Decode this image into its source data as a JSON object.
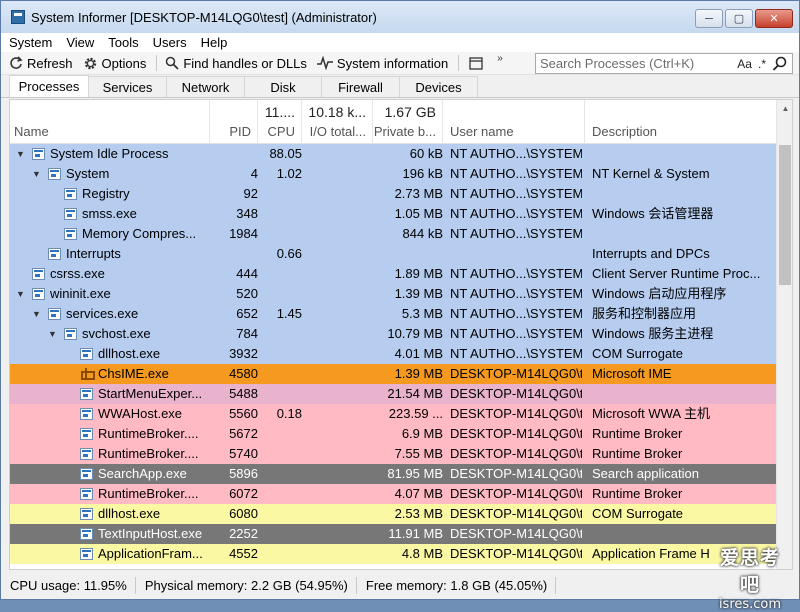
{
  "window": {
    "title": "System Informer [DESKTOP-M14LQG0\\test] (Administrator)",
    "minimize_glyph": "─",
    "maximize_glyph": "▢",
    "close_glyph": "✕"
  },
  "menu": [
    "System",
    "View",
    "Tools",
    "Users",
    "Help"
  ],
  "toolbar": {
    "refresh": "Refresh",
    "options": "Options",
    "find": "Find handles or DLLs",
    "sysinfo": "System information",
    "more": "»"
  },
  "search": {
    "placeholder": "Search Processes (Ctrl+K)",
    "case_option": "Aa",
    "regex_option": ".*"
  },
  "tabs": [
    "Processes",
    "Services",
    "Network",
    "Disk",
    "Firewall",
    "Devices"
  ],
  "columns": {
    "name": "Name",
    "pid": "PID",
    "cpu": "CPU",
    "io": "I/O total...",
    "private": "Private b...",
    "user": "User name",
    "desc": "Description",
    "cpu_total": "11....",
    "io_total": "10.18 k...",
    "private_total": "1.67 GB"
  },
  "colors": {
    "system": "#b6cdf0",
    "service": "#b6cdf0",
    "ime": "#f59a1f",
    "immersive": "#e9b3cd",
    "user": "#ffbac4",
    "suspended": "#777777",
    "dotnet": "#fbf8a4"
  },
  "processes": [
    {
      "name": "System Idle Process",
      "level": 0,
      "expanded": true,
      "pid": "",
      "cpu": "88.05",
      "private": "60 kB",
      "user": "NT AUTHO...\\SYSTEM",
      "desc": "",
      "color": "system"
    },
    {
      "name": "System",
      "level": 1,
      "expanded": true,
      "pid": "4",
      "cpu": "1.02",
      "private": "196 kB",
      "user": "NT AUTHO...\\SYSTEM",
      "desc": "NT Kernel & System",
      "color": "system"
    },
    {
      "name": "Registry",
      "level": 2,
      "expanded": null,
      "pid": "92",
      "cpu": "",
      "private": "2.73 MB",
      "user": "NT AUTHO...\\SYSTEM",
      "desc": "",
      "color": "system"
    },
    {
      "name": "smss.exe",
      "level": 2,
      "expanded": null,
      "pid": "348",
      "cpu": "",
      "private": "1.05 MB",
      "user": "NT AUTHO...\\SYSTEM",
      "desc": "Windows 会话管理器",
      "color": "system"
    },
    {
      "name": "Memory Compres...",
      "level": 2,
      "expanded": null,
      "pid": "1984",
      "cpu": "",
      "private": "844 kB",
      "user": "NT AUTHO...\\SYSTEM",
      "desc": "",
      "color": "system"
    },
    {
      "name": "Interrupts",
      "level": 1,
      "expanded": null,
      "pid": "",
      "cpu": "0.66",
      "private": "",
      "user": "",
      "desc": "Interrupts and DPCs",
      "color": "system"
    },
    {
      "name": "csrss.exe",
      "level": 0,
      "expanded": null,
      "pid": "444",
      "cpu": "",
      "private": "1.89 MB",
      "user": "NT AUTHO...\\SYSTEM",
      "desc": "Client Server Runtime Proc...",
      "color": "system"
    },
    {
      "name": "wininit.exe",
      "level": 0,
      "expanded": true,
      "pid": "520",
      "cpu": "",
      "private": "1.39 MB",
      "user": "NT AUTHO...\\SYSTEM",
      "desc": "Windows 启动应用程序",
      "color": "system"
    },
    {
      "name": "services.exe",
      "level": 1,
      "expanded": true,
      "pid": "652",
      "cpu": "1.45",
      "private": "5.3 MB",
      "user": "NT AUTHO...\\SYSTEM",
      "desc": "服务和控制器应用",
      "color": "system"
    },
    {
      "name": "svchost.exe",
      "level": 2,
      "expanded": true,
      "pid": "784",
      "cpu": "",
      "private": "10.79 MB",
      "user": "NT AUTHO...\\SYSTEM",
      "desc": "Windows 服务主进程",
      "color": "service"
    },
    {
      "name": "dllhost.exe",
      "level": 3,
      "expanded": null,
      "pid": "3932",
      "cpu": "",
      "private": "4.01 MB",
      "user": "NT AUTHO...\\SYSTEM",
      "desc": "COM Surrogate",
      "color": "service"
    },
    {
      "name": "ChsIME.exe",
      "level": 3,
      "expanded": null,
      "pid": "4580",
      "cpu": "",
      "private": "1.39 MB",
      "user": "DESKTOP-M14LQG0\\t",
      "desc": "Microsoft IME",
      "color": "ime",
      "icon": "ime"
    },
    {
      "name": "StartMenuExper...",
      "level": 3,
      "expanded": null,
      "pid": "5488",
      "cpu": "",
      "private": "21.54 MB",
      "user": "DESKTOP-M14LQG0\\t",
      "desc": "",
      "color": "immersive"
    },
    {
      "name": "WWAHost.exe",
      "level": 3,
      "expanded": null,
      "pid": "5560",
      "cpu": "0.18",
      "private": "223.59 ...",
      "user": "DESKTOP-M14LQG0\\t",
      "desc": "Microsoft WWA 主机",
      "color": "user"
    },
    {
      "name": "RuntimeBroker....",
      "level": 3,
      "expanded": null,
      "pid": "5672",
      "cpu": "",
      "private": "6.9 MB",
      "user": "DESKTOP-M14LQG0\\t",
      "desc": "Runtime Broker",
      "color": "user"
    },
    {
      "name": "RuntimeBroker....",
      "level": 3,
      "expanded": null,
      "pid": "5740",
      "cpu": "",
      "private": "7.55 MB",
      "user": "DESKTOP-M14LQG0\\t",
      "desc": "Runtime Broker",
      "color": "user"
    },
    {
      "name": "SearchApp.exe",
      "level": 3,
      "expanded": null,
      "pid": "5896",
      "cpu": "",
      "private": "81.95 MB",
      "user": "DESKTOP-M14LQG0\\t",
      "desc": "Search application",
      "color": "suspended"
    },
    {
      "name": "RuntimeBroker....",
      "level": 3,
      "expanded": null,
      "pid": "6072",
      "cpu": "",
      "private": "4.07 MB",
      "user": "DESKTOP-M14LQG0\\t",
      "desc": "Runtime Broker",
      "color": "user"
    },
    {
      "name": "dllhost.exe",
      "level": 3,
      "expanded": null,
      "pid": "6080",
      "cpu": "",
      "private": "2.53 MB",
      "user": "DESKTOP-M14LQG0\\t",
      "desc": "COM Surrogate",
      "color": "dotnet"
    },
    {
      "name": "TextInputHost.exe",
      "level": 3,
      "expanded": null,
      "pid": "2252",
      "cpu": "",
      "private": "11.91 MB",
      "user": "DESKTOP-M14LQG0\\t",
      "desc": "",
      "color": "suspended"
    },
    {
      "name": "ApplicationFram...",
      "level": 3,
      "expanded": null,
      "pid": "4552",
      "cpu": "",
      "private": "4.8 MB",
      "user": "DESKTOP-M14LQG0\\t",
      "desc": "Application Frame H",
      "color": "dotnet"
    }
  ],
  "status": {
    "cpu": "CPU usage: 11.95%",
    "physical": "Physical memory: 2.2 GB (54.95%)",
    "free": "Free memory: 1.8 GB (45.05%)"
  },
  "watermark": {
    "line1": "爱思考吧",
    "line2": "isres.com"
  }
}
